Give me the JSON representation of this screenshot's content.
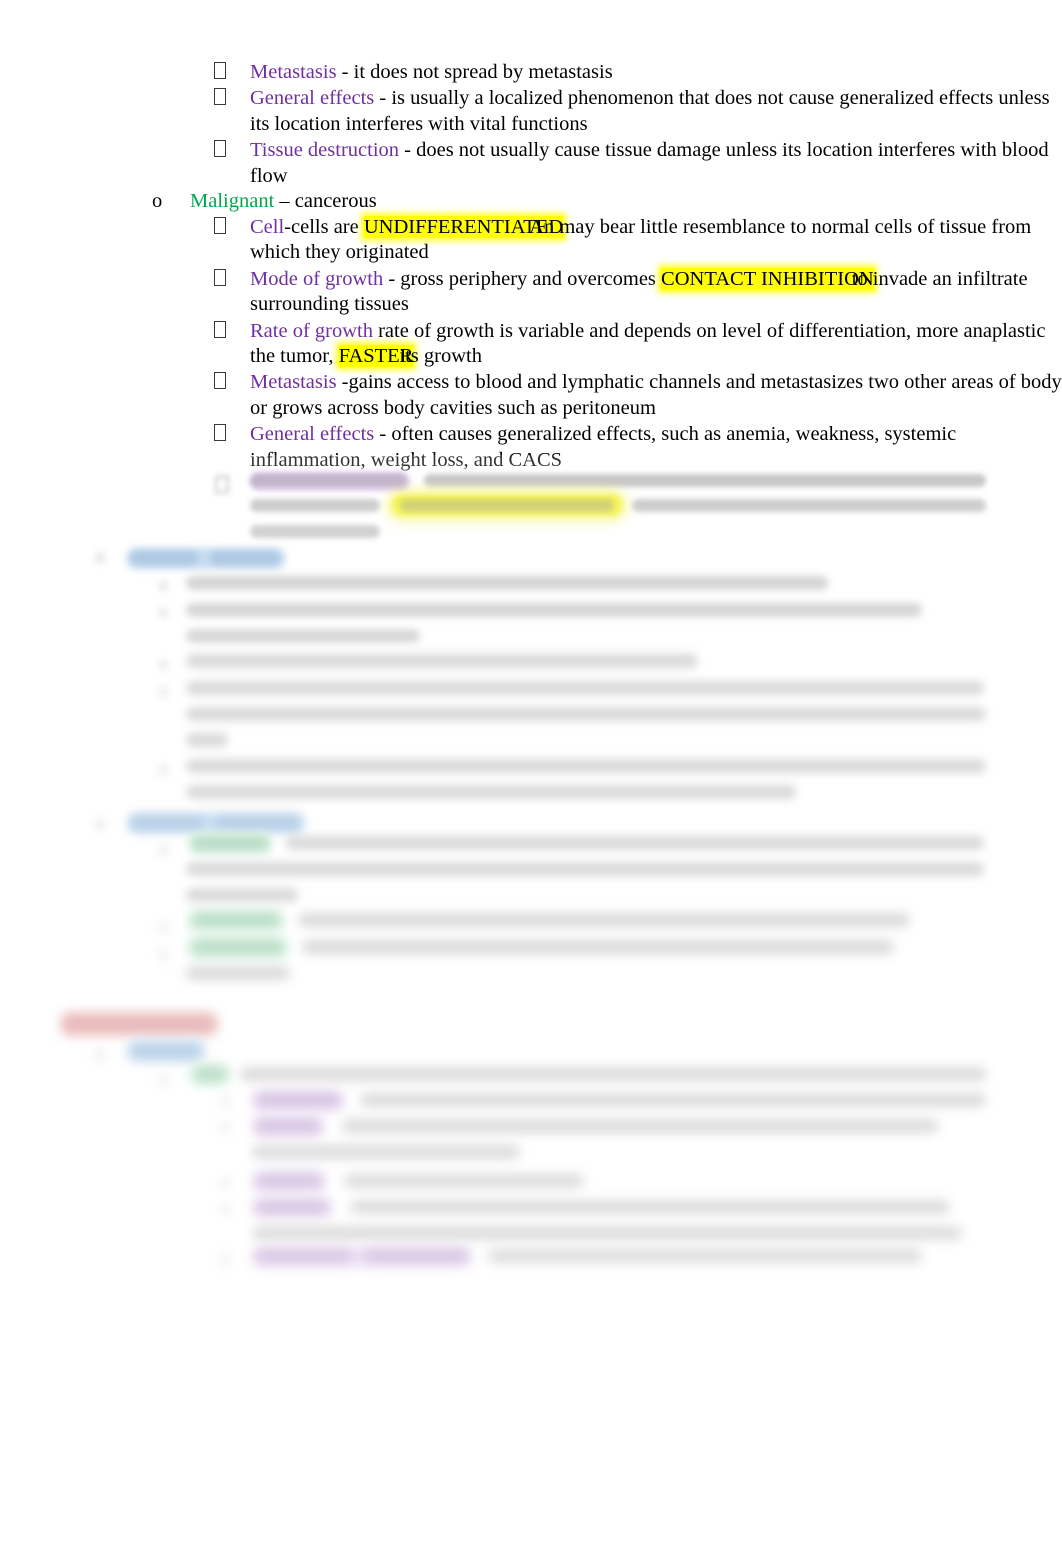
{
  "document": {
    "type": "study-notes",
    "page_background": "#ffffff",
    "colors": {
      "term_purple": "#7030A0",
      "term_green": "#00A64F",
      "highlight_yellow": "#FFFF00",
      "highlight_blue": "#9DC3E6",
      "highlight_green": "#A9E5BE",
      "highlight_red": "#E79A9A",
      "highlight_lavender": "#D5B8E8",
      "body_text": "#000000"
    },
    "bullet_glyph": "tofu-box",
    "note": "Lower portion of the page is blurred out (document preview fade)."
  },
  "benign_section": {
    "items": [
      {
        "term": "Metastasis",
        "term_color": "purple",
        "text": " - it does not spread by metastasis"
      },
      {
        "term": "General effects",
        "term_color": "purple",
        "text": " - is usually a localized phenomenon that does not cause generalized effects unless its location interferes with vital functions"
      },
      {
        "term": "Tissue destruction",
        "term_color": "purple",
        "text": " - does not usually cause tissue damage unless its location interferes with blood flow"
      }
    ]
  },
  "malignant_section": {
    "heading_marker": "o",
    "heading_term": "Malignant",
    "heading_rest": " – cancerous",
    "items": [
      {
        "term": "Cell",
        "pre": "-cells are ",
        "highlight": "UNDIFFERENTIATED",
        "post": "An may bear little resemblance to normal cells of tissue from which they originated"
      },
      {
        "term": "Mode of growth",
        "pre": " - gross periphery and overcomes ",
        "highlight": "CONTACT INHIBITION",
        "post": "to invade an infiltrate surrounding tissues"
      },
      {
        "term": "Rate of growth",
        "pre": " rate of growth is variable and depends on level of differentiation, more anaplastic the tumor, ",
        "highlight": "FASTER",
        "post": "its growth"
      },
      {
        "term": "Metastasis",
        "pre": " -gains access to blood and lymphatic channels and metastasizes two other areas of body or grows across body cavities such as peritoneum",
        "highlight": "",
        "post": ""
      },
      {
        "term": "General effects",
        "pre": " - often causes generalized effects, such as anemia, weakness, systemic inflammation, weight loss, and CACS",
        "highlight": "",
        "post": ""
      }
    ]
  },
  "obscured": {
    "label": "blurred-content",
    "description": "Remaining page content is blurred and illegible in the screenshot."
  }
}
